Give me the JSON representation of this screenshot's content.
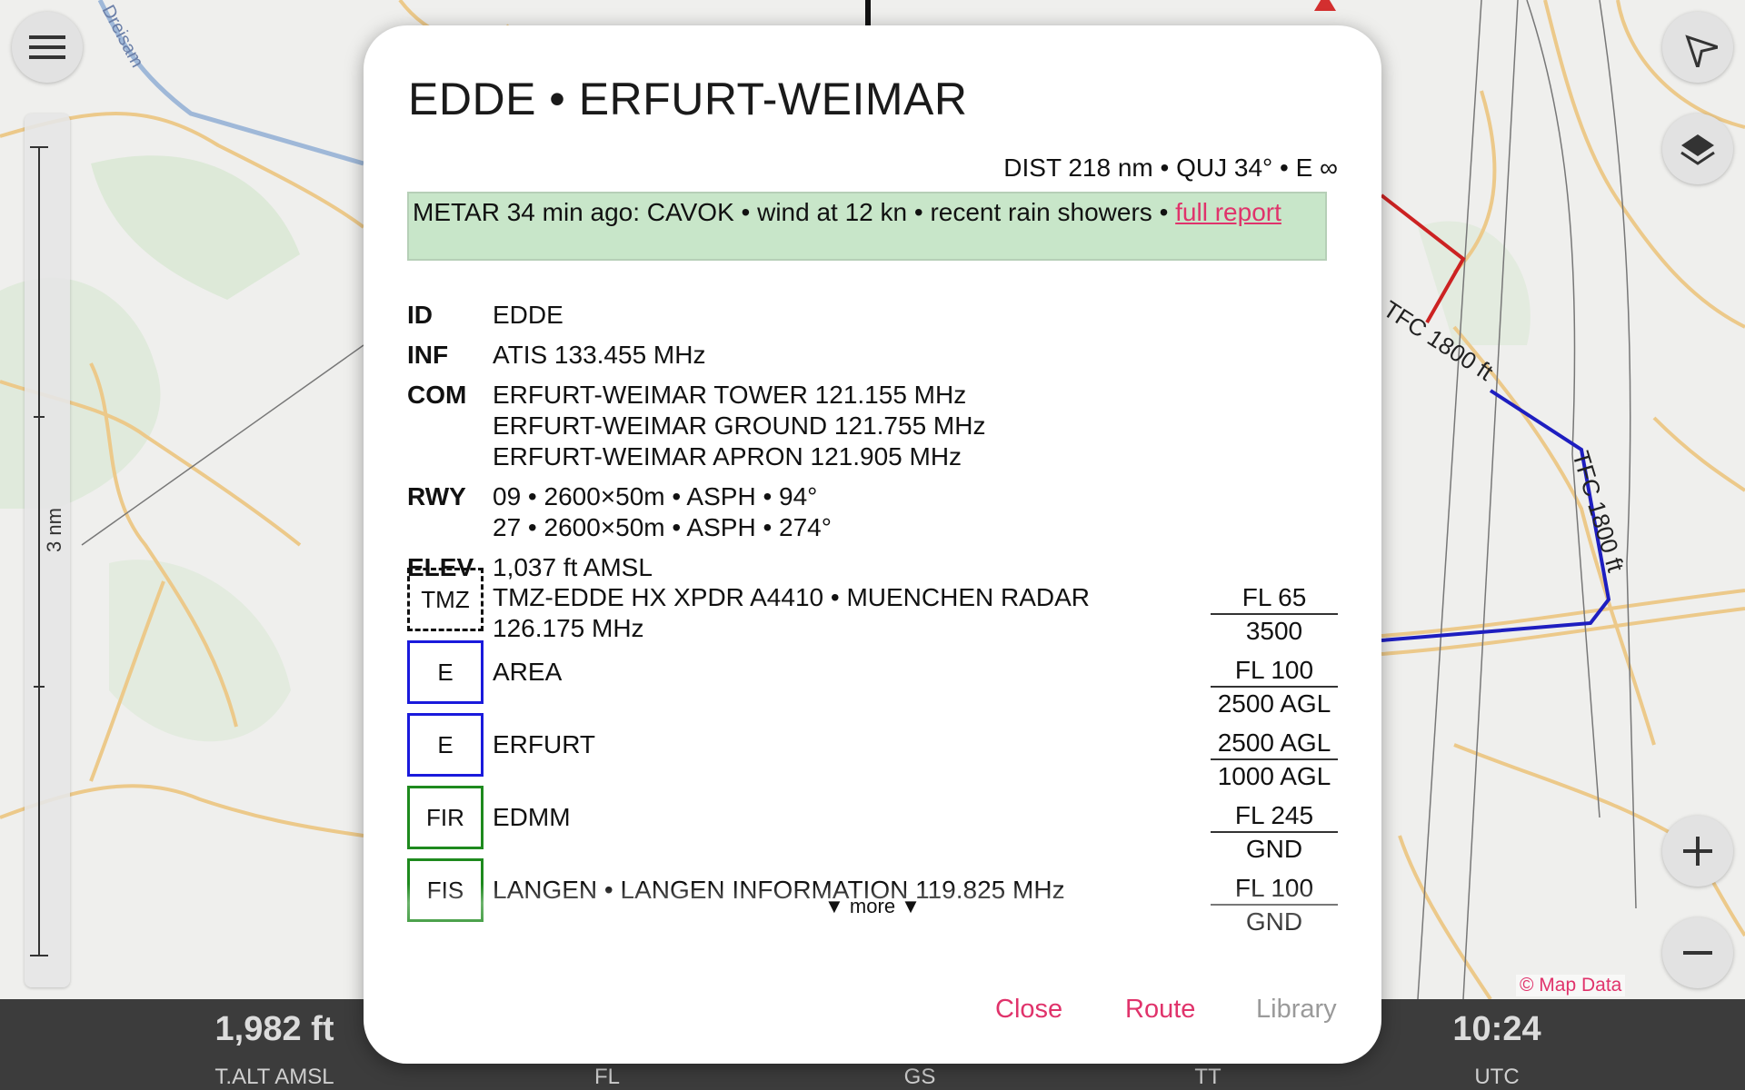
{
  "map": {
    "river_label": "Dreisam",
    "scale_label": "3 nm",
    "traffic_labels": [
      "TFC 1800 ft",
      "TFC 1800 ft"
    ],
    "attribution": "© Map Data",
    "menu_icon": "hamburger-menu-icon",
    "north_icon": "north-arrow-icon",
    "layers_icon": "layers-icon",
    "zoom_in_icon": "plus-icon",
    "zoom_out_icon": "minus-icon"
  },
  "status_bar": {
    "cells": [
      {
        "value": "1,982 ft",
        "label": "T.ALT AMSL"
      },
      {
        "value": "",
        "label": "FL"
      },
      {
        "value": "",
        "label": "GS"
      },
      {
        "value": "",
        "label": "TT"
      },
      {
        "value": "10:24",
        "label": "UTC"
      }
    ]
  },
  "dialog": {
    "title": "EDDE • ERFURT-WEIMAR",
    "dist_line": "DIST 218 nm • QUJ 34° • E ∞",
    "metar": {
      "text": "METAR 34 min ago: CAVOK • wind at 12 kn • recent rain showers • ",
      "link": "full report",
      "color": "#c8e6c9"
    },
    "rows": {
      "id": {
        "key": "ID",
        "values": [
          "EDDE"
        ]
      },
      "inf": {
        "key": "INF",
        "values": [
          "ATIS 133.455 MHz"
        ]
      },
      "com": {
        "key": "COM",
        "values": [
          "ERFURT-WEIMAR TOWER 121.155 MHz",
          "ERFURT-WEIMAR GROUND 121.755 MHz",
          "ERFURT-WEIMAR APRON 121.905 MHz"
        ]
      },
      "rwy": {
        "key": "RWY",
        "values": [
          "09 • 2600×50m • ASPH • 94°",
          "27 • 2600×50m • ASPH • 274°"
        ]
      },
      "elev": {
        "key": "ELEV",
        "values": [
          "1,037 ft AMSL"
        ]
      }
    },
    "airspaces": [
      {
        "box": "TMZ",
        "name_lines": [
          "TMZ-EDDE HX XPDR A4410 • MUENCHEN RADAR",
          "126.175 MHz"
        ],
        "top": "FL 65",
        "bottom": "3500",
        "style": "dashed",
        "color": "#111111"
      },
      {
        "box": "E",
        "name_lines": [
          "AREA"
        ],
        "top": "FL 100",
        "bottom": "2500 AGL",
        "style": "solid",
        "color": "#1a1adc"
      },
      {
        "box": "E",
        "name_lines": [
          "ERFURT"
        ],
        "top": "2500 AGL",
        "bottom": "1000 AGL",
        "style": "solid",
        "color": "#1a1adc"
      },
      {
        "box": "FIR",
        "name_lines": [
          "EDMM"
        ],
        "top": "FL 245",
        "bottom": "GND",
        "style": "solid",
        "color": "#1e8a1e"
      },
      {
        "box": "FIS",
        "name_lines": [
          "LANGEN • LANGEN INFORMATION 119.825 MHz"
        ],
        "top": "FL 100",
        "bottom": "GND",
        "style": "solid",
        "color": "#1e8a1e"
      }
    ],
    "more": "▼ more ▼",
    "buttons": {
      "close": "Close",
      "route": "Route",
      "library": "Library",
      "accent": "#e0336b",
      "disabled": "#9a9a9a"
    }
  }
}
